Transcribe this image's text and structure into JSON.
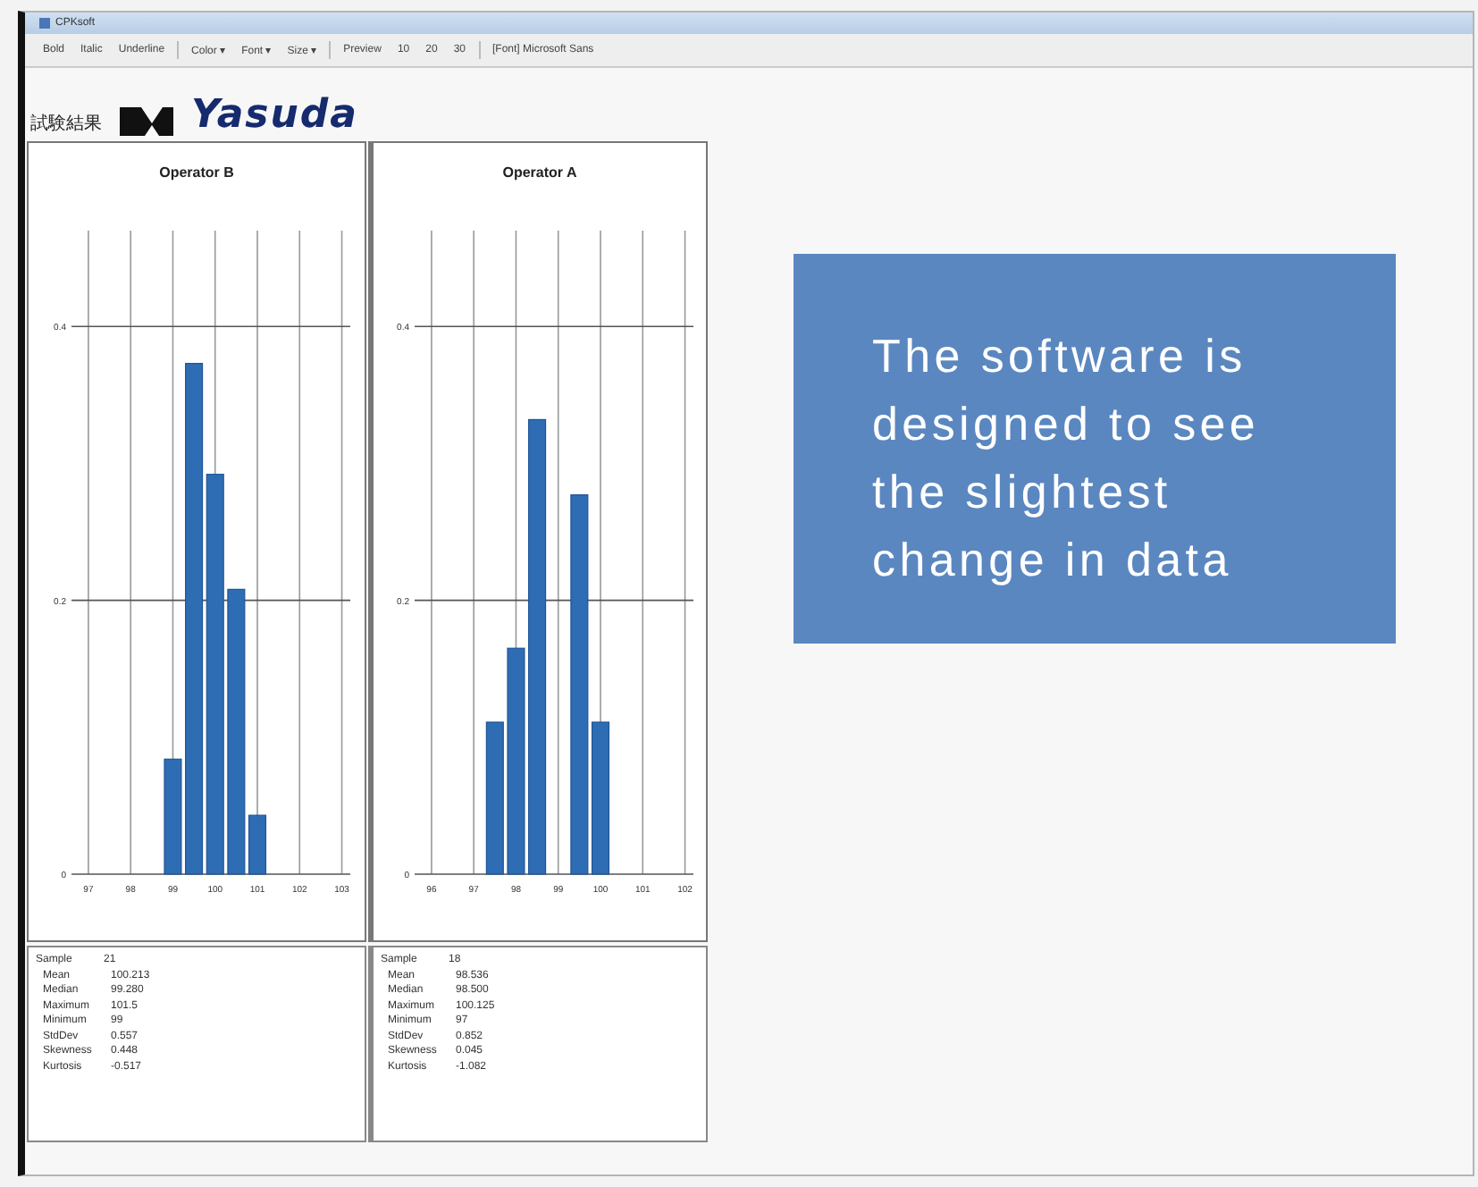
{
  "window": {
    "title": "CPKsoft"
  },
  "toolbar": {
    "items": [
      "Bold",
      "Italic",
      "Underline",
      "Color ▾",
      "Font ▾",
      "Size ▾",
      "Preview",
      "10",
      "20",
      "30",
      "[Font] Microsoft Sans"
    ]
  },
  "header": {
    "label": "試験結果",
    "logo": "Yasuda"
  },
  "charts": [
    {
      "title": "Operator B",
      "chart_data": {
        "type": "bar",
        "x": [
          99,
          99.5,
          100,
          100.5,
          101
        ],
        "values": [
          0.084,
          0.373,
          0.292,
          0.208,
          0.043
        ],
        "grid": true,
        "xlim": [
          96.6,
          103.2
        ],
        "ylim": [
          0,
          0.47
        ],
        "xticks": [
          97,
          98,
          99,
          100,
          101,
          102,
          103
        ],
        "yticks": [
          {
            "value": 0,
            "label": "0"
          },
          {
            "value": 0.2,
            "label": "0.2"
          },
          {
            "value": 0.4,
            "label": "0.4"
          }
        ]
      }
    },
    {
      "title": "Operator A",
      "chart_data": {
        "type": "bar",
        "x": [
          97.5,
          98,
          98.5,
          99.5,
          100
        ],
        "values": [
          0.111,
          0.165,
          0.332,
          0.277,
          0.111
        ],
        "grid": true,
        "xlim": [
          95.6,
          102.2
        ],
        "ylim": [
          0,
          0.47
        ],
        "xticks": [
          96,
          97,
          98,
          99,
          100,
          101,
          102
        ],
        "yticks": [
          {
            "value": 0,
            "label": "0"
          },
          {
            "value": 0.2,
            "label": "0.2"
          },
          {
            "value": 0.4,
            "label": "0.4"
          }
        ]
      }
    }
  ],
  "stats": [
    {
      "sample_label": "Sample",
      "sample": "21",
      "rows": [
        {
          "label": "Mean",
          "value": "100.213"
        },
        {
          "label": "Median",
          "value": "99.280"
        },
        {
          "label": "Maximum",
          "value": "101.5"
        },
        {
          "label": "Minimum",
          "value": "99"
        },
        {
          "label": "StdDev",
          "value": "0.557"
        },
        {
          "label": "Skewness",
          "value": "0.448"
        },
        {
          "label": "Kurtosis",
          "value": "-0.517"
        }
      ]
    },
    {
      "sample_label": "Sample",
      "sample": "18",
      "rows": [
        {
          "label": "Mean",
          "value": "98.536"
        },
        {
          "label": "Median",
          "value": "98.500"
        },
        {
          "label": "Maximum",
          "value": "100.125"
        },
        {
          "label": "Minimum",
          "value": "97"
        },
        {
          "label": "StdDev",
          "value": "0.852"
        },
        {
          "label": "Skewness",
          "value": "0.045"
        },
        {
          "label": "Kurtosis",
          "value": "-1.082"
        }
      ]
    }
  ],
  "callout": {
    "text": "The software is designed to see the slightest change in data"
  }
}
